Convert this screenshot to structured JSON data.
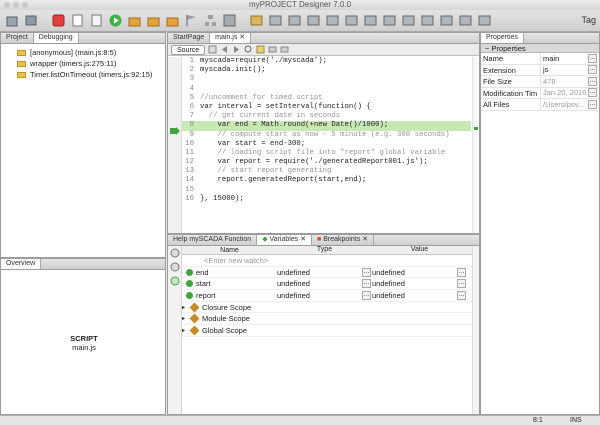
{
  "window": {
    "title": "myPROJECT Designer 7.0.0"
  },
  "toolbar": {
    "tag_label": "Tag"
  },
  "left_panel": {
    "tabs": [
      "Project",
      "Debugging"
    ],
    "call_stack": [
      "[anonymous] (main.js:8:5)",
      "wrapper (timers.js:275:11)",
      "Timer.listOnTimeout (timers.js:92:15)"
    ]
  },
  "overview": {
    "tab": "Overview",
    "title": "SCRIPT",
    "file": "main.js"
  },
  "editor": {
    "tabs": [
      "StartPage",
      "main.js"
    ],
    "source_label": "Source",
    "lines": [
      {
        "n": "1",
        "text": "myscada=require('./myscada');",
        "kind": "code"
      },
      {
        "n": "2",
        "text": "myscada.init();",
        "kind": "code"
      },
      {
        "n": "3",
        "text": "",
        "kind": "code"
      },
      {
        "n": "4",
        "text": "",
        "kind": "code"
      },
      {
        "n": "5",
        "text": "//uncomment for timed script",
        "kind": "comment"
      },
      {
        "n": "6",
        "text": "var interval = setInterval(function() {",
        "kind": "code"
      },
      {
        "n": "7",
        "text": "  // get current date in seconds",
        "kind": "comment"
      },
      {
        "n": "8",
        "text": "    var end = Math.round(+new Date()/1000);",
        "kind": "highlight"
      },
      {
        "n": "9",
        "text": "    // compute start as now - 5 minute (e.g. 300 seconds)",
        "kind": "comment"
      },
      {
        "n": "10",
        "text": "    var start = end-300;",
        "kind": "code"
      },
      {
        "n": "11",
        "text": "    // loading script file into \"report\" global variable",
        "kind": "comment"
      },
      {
        "n": "12",
        "text": "    var report = require('./generatedReport001.js');",
        "kind": "code"
      },
      {
        "n": "13",
        "text": "    // start report generating",
        "kind": "comment"
      },
      {
        "n": "14",
        "text": "    report.generatedReport(start,end);",
        "kind": "code"
      },
      {
        "n": "15",
        "text": "",
        "kind": "code"
      },
      {
        "n": "16",
        "text": "}, 15000);",
        "kind": "code"
      }
    ]
  },
  "bottom_panel": {
    "tabs": [
      "Help mySCADA Function",
      "Variables",
      "Breakpoints"
    ],
    "columns": [
      "Name",
      "Type",
      "Value"
    ],
    "new_watch": "<Enter new watch>",
    "variables": [
      {
        "name": "end",
        "type": "undefined",
        "value": "undefined"
      },
      {
        "name": "start",
        "type": "undefined",
        "value": "undefined"
      },
      {
        "name": "report",
        "type": "undefined",
        "value": "undefined"
      }
    ],
    "scopes": [
      "Closure Scope",
      "Module Scope",
      "Global Scope"
    ]
  },
  "properties": {
    "tab": "Properties",
    "section": "Properties",
    "rows": [
      {
        "key": "Name",
        "value": "main"
      },
      {
        "key": "Extension",
        "value": "js"
      },
      {
        "key": "File Size",
        "value": "478"
      },
      {
        "key": "Modification Tim",
        "value": "Jan 20, 2016 8..."
      },
      {
        "key": "All Files",
        "value": "/Users/psv..."
      }
    ]
  },
  "status": {
    "position": "8:1",
    "mode": "INS"
  }
}
